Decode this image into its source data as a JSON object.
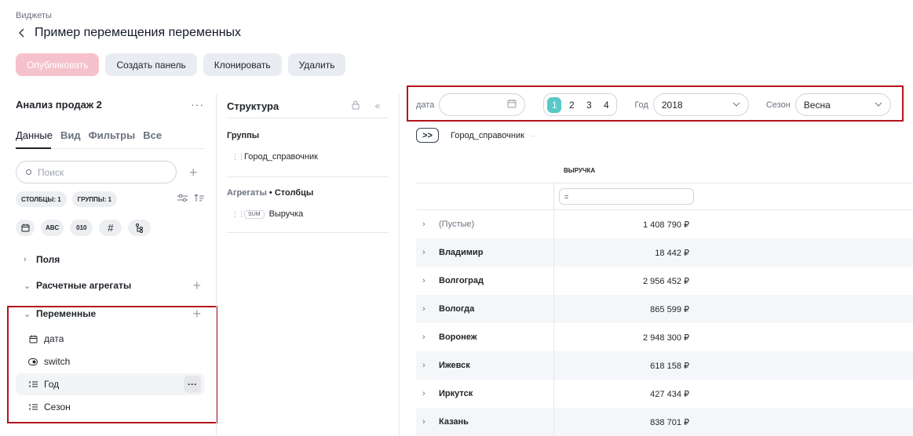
{
  "breadcrumb": "Виджеты",
  "page_title": "Пример перемещения переменных",
  "toolbar": {
    "publish": "Опубликовать",
    "create_panel": "Создать панель",
    "clone": "Клонировать",
    "delete": "Удалить"
  },
  "left": {
    "title": "Анализ продаж 2",
    "tabs": [
      "Данные",
      "Вид",
      "Фильтры",
      "Все"
    ],
    "search_placeholder": "Поиск",
    "chips": [
      "СТОЛБЦЫ: 1",
      "ГРУППЫ: 1"
    ],
    "type_chips": [
      "ABC",
      "010",
      "#"
    ],
    "tree": {
      "fields": "Поля",
      "calc": "Расчетные агрегаты",
      "variables": "Переменные"
    },
    "variables": [
      "дата",
      "switch",
      "Год",
      "Сезон"
    ]
  },
  "mid": {
    "title": "Структура",
    "groups_title": "Группы",
    "group_field": "Город_справочник",
    "agg_title_muted": "Агрегаты",
    "agg_title": "• Столбцы",
    "sum_badge": "SUM",
    "agg_field": "Выручка"
  },
  "filters": {
    "date_label": "дата",
    "pages": [
      "1",
      "2",
      "3",
      "4"
    ],
    "active_page": "1",
    "year_label": "Год",
    "year_value": "2018",
    "season_label": "Сезон",
    "season_value": "Весна"
  },
  "grid": {
    "expand_label": ">>",
    "row_field": "Город_справочник",
    "column_header": "ВЫРУЧКА",
    "filter_symbol": "=",
    "rows": [
      {
        "city": "(Пустые)",
        "value": "1 408 790 ₽"
      },
      {
        "city": "Владимир",
        "value": "18 442 ₽"
      },
      {
        "city": "Волгоград",
        "value": "2 956 452 ₽"
      },
      {
        "city": "Вологда",
        "value": "865 599 ₽"
      },
      {
        "city": "Воронеж",
        "value": "2 948 300 ₽"
      },
      {
        "city": "Ижевск",
        "value": "618 158 ₽"
      },
      {
        "city": "Иркутск",
        "value": "427 434 ₽"
      },
      {
        "city": "Казань",
        "value": "838 701 ₽"
      }
    ]
  }
}
